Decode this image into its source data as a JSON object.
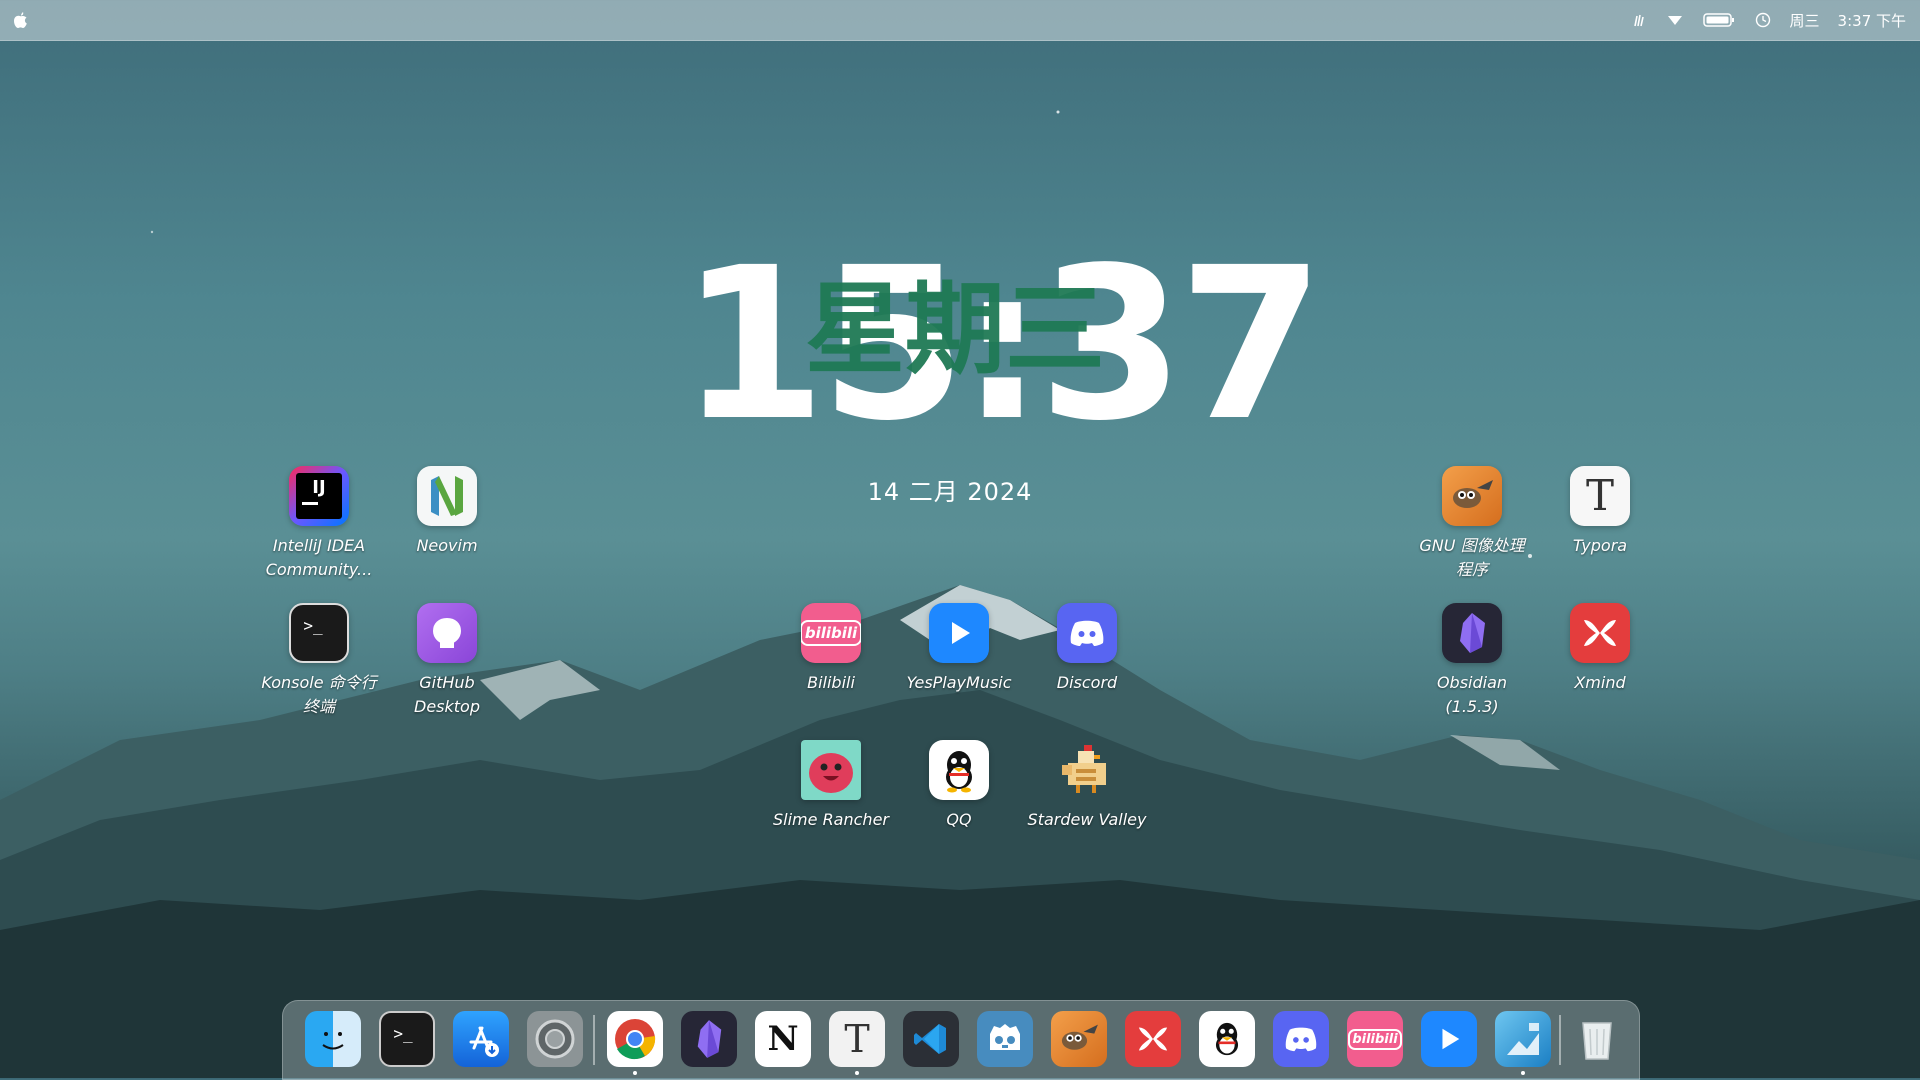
{
  "menubar": {
    "weekday": "周三",
    "time": "3:37 下午"
  },
  "clock": {
    "time": "15:37",
    "weekday": "星期三",
    "date": "14 二月 2024"
  },
  "desktop_icons": [
    {
      "label": "IntelliJ IDEA Community...",
      "icon": "intellij-icon"
    },
    {
      "label": "Neovim",
      "icon": "neovim-icon"
    },
    {
      "label": "Konsole 命令行终端",
      "icon": "terminal-icon"
    },
    {
      "label": "GitHub Desktop",
      "icon": "github-icon"
    },
    {
      "label": "Bilibili",
      "icon": "bilibili-icon"
    },
    {
      "label": "YesPlayMusic",
      "icon": "play-icon"
    },
    {
      "label": "Discord",
      "icon": "discord-icon"
    },
    {
      "label": "Slime Rancher",
      "icon": "slime-icon"
    },
    {
      "label": "QQ",
      "icon": "qq-icon"
    },
    {
      "label": "Stardew Valley",
      "icon": "chicken-icon"
    },
    {
      "label": "GNU 图像处理程序",
      "icon": "gimp-icon"
    },
    {
      "label": "Typora",
      "icon": "typora-icon"
    },
    {
      "label": "Obsidian (1.5.3)",
      "icon": "obsidian-icon"
    },
    {
      "label": "Xmind",
      "icon": "xmind-icon"
    }
  ],
  "dock": {
    "items": [
      "finder-icon",
      "terminal-icon",
      "app-store-icon",
      "settings-icon",
      "chrome-icon",
      "obsidian-icon",
      "notion-icon",
      "typora-icon",
      "vscode-icon",
      "godot-icon",
      "gimp-icon",
      "xmind-icon",
      "qq-icon",
      "discord-icon",
      "bilibili-icon",
      "play-icon",
      "image-viewer-icon",
      "trash-icon"
    ]
  },
  "colors": {
    "clock_weekday": "#1f7a55",
    "menubar_bg": "#d6e0e4"
  }
}
